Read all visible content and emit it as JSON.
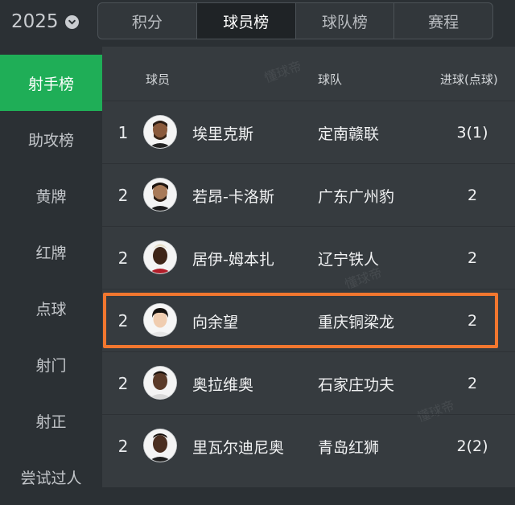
{
  "season": {
    "year": "2025",
    "icon": "chevron-down-icon"
  },
  "tabs": [
    {
      "label": "积分",
      "active": false
    },
    {
      "label": "球员榜",
      "active": true
    },
    {
      "label": "球队榜",
      "active": false
    },
    {
      "label": "赛程",
      "active": false
    }
  ],
  "sidebar": {
    "items": [
      {
        "label": "射手榜",
        "active": true
      },
      {
        "label": "助攻榜",
        "active": false
      },
      {
        "label": "黄牌",
        "active": false
      },
      {
        "label": "红牌",
        "active": false
      },
      {
        "label": "点球",
        "active": false
      },
      {
        "label": "射门",
        "active": false
      },
      {
        "label": "射正",
        "active": false
      },
      {
        "label": "尝试过人",
        "active": false
      }
    ]
  },
  "table": {
    "headers": {
      "player": "球员",
      "team": "球队",
      "goals": "进球(点球)"
    },
    "rows": [
      {
        "rank": "1",
        "player": "埃里克斯",
        "team": "定南赣联",
        "goals": "3(1)"
      },
      {
        "rank": "2",
        "player": "若昂-卡洛斯",
        "team": "广东广州豹",
        "goals": "2"
      },
      {
        "rank": "2",
        "player": "居伊-姆本扎",
        "team": "辽宁铁人",
        "goals": "2"
      },
      {
        "rank": "2",
        "player": "向余望",
        "team": "重庆铜梁龙",
        "goals": "2"
      },
      {
        "rank": "2",
        "player": "奥拉维奥",
        "team": "石家庄功夫",
        "goals": "2"
      },
      {
        "rank": "2",
        "player": "里瓦尔迪尼奥",
        "team": "青岛红狮",
        "goals": "2(2)"
      }
    ],
    "highlighted_row": 3
  },
  "watermark": "懂球帝",
  "colors": {
    "accent_green": "#1fae57",
    "highlight_orange": "#f2772f",
    "background": "#363b3f"
  }
}
